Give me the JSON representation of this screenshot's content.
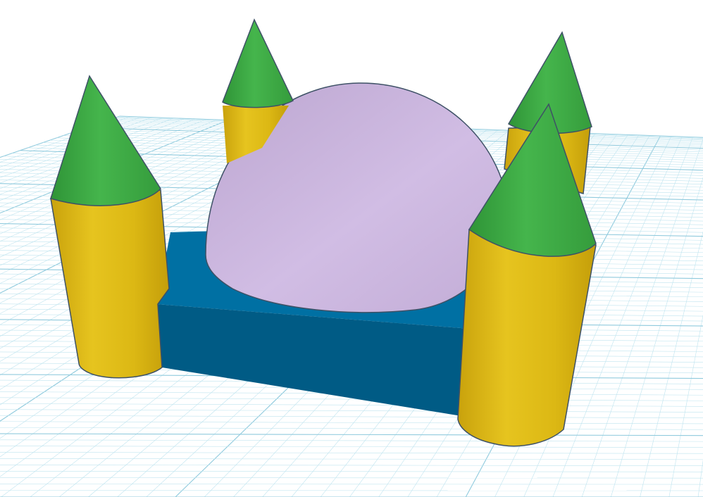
{
  "viewport": {
    "background": "#ffffff",
    "grid_line_color": "#bfe4ef",
    "grid_major_color": "#8fcadd"
  },
  "model": {
    "base": {
      "top_color": "#0070a3",
      "front_color": "#005b85",
      "right_color": "#004f75"
    },
    "dome": {
      "color": "#cbb4de",
      "shade_color": "#b9a1cc"
    },
    "towers": {
      "body_color": "#e2be18",
      "body_shade": "#c9a40c",
      "roof_color": "#3faf46",
      "roof_shade": "#2f9437"
    },
    "outline_color": "#3e5166"
  }
}
